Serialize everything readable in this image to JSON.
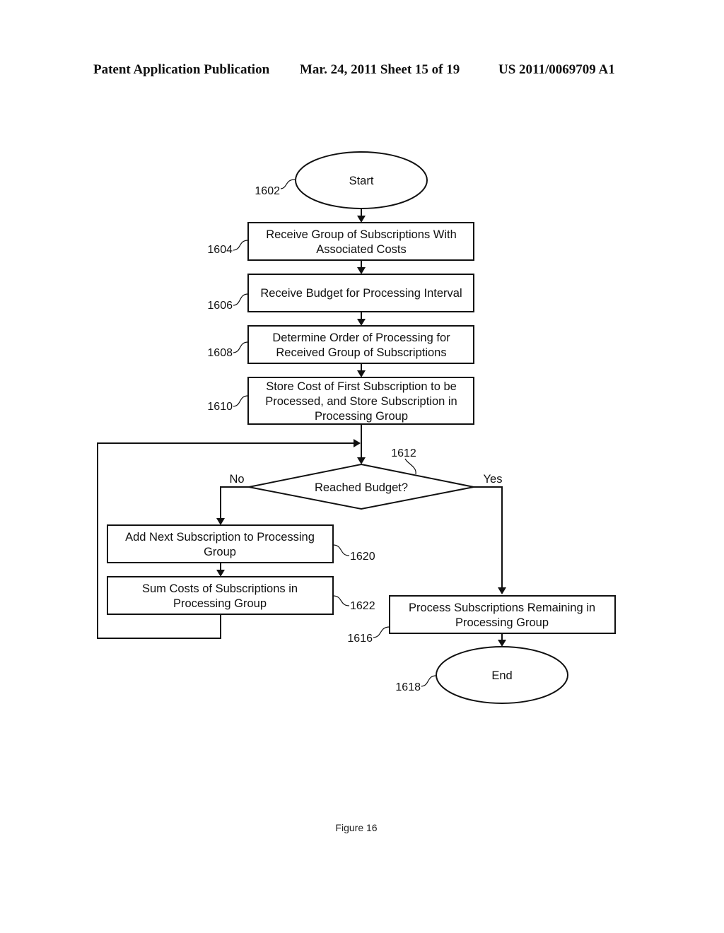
{
  "header": {
    "publication": "Patent Application Publication",
    "date_sheet": "Mar. 24, 2011  Sheet 15 of 19",
    "number": "US 2011/0069709 A1"
  },
  "diagram": {
    "nodes": {
      "start": {
        "ref": "1602",
        "lines": [
          "Start"
        ]
      },
      "receive_group": {
        "ref": "1604",
        "lines": [
          "Receive Group of Subscriptions With",
          "Associated Costs"
        ]
      },
      "receive_budget": {
        "ref": "1606",
        "lines": [
          "Receive Budget for Processing Interval"
        ]
      },
      "determine_order": {
        "ref": "1608",
        "lines": [
          "Determine Order of Processing for",
          "Received Group of Subscriptions"
        ]
      },
      "store_cost": {
        "ref": "1610",
        "lines": [
          "Store Cost of First Subscription to be",
          "Processed, and Store Subscription in",
          "Processing Group"
        ]
      },
      "decision": {
        "ref": "1612",
        "lines": [
          "Reached Budget?"
        ],
        "no_label": "No",
        "yes_label": "Yes"
      },
      "add_next": {
        "ref": "1620",
        "lines": [
          "Add Next Subscription to Processing",
          "Group"
        ]
      },
      "sum_costs": {
        "ref": "1622",
        "lines": [
          "Sum Costs of Subscriptions in",
          "Processing Group"
        ]
      },
      "process_remaining": {
        "ref": "1616",
        "lines": [
          "Process Subscriptions Remaining in",
          "Processing Group"
        ]
      },
      "end": {
        "ref": "1618",
        "lines": [
          "End"
        ]
      }
    }
  },
  "caption": "Figure 16"
}
